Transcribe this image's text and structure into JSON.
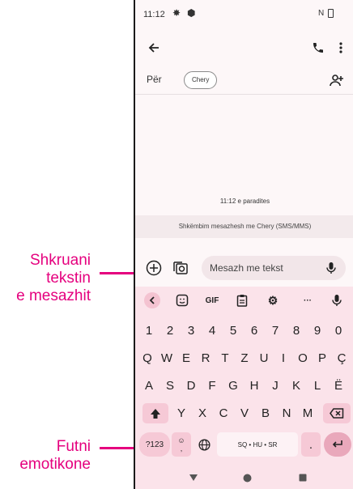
{
  "annotations": {
    "type_message": [
      "Shkruani",
      "tekstin",
      "e mesazhit"
    ],
    "insert_emoji": [
      "Futni",
      "emotikone"
    ]
  },
  "status_bar": {
    "time": "11:12"
  },
  "conversation": {
    "to_label": "Për",
    "recipient_chip": "Chery",
    "timestamp": "11:12 e paradites",
    "info_banner": "Shkëmbim mesazhesh me Chery (SMS/MMS)"
  },
  "composer": {
    "placeholder": "Mesazh me tekst"
  },
  "keyboard": {
    "toolbar": {
      "gif": "GIF",
      "more": "···"
    },
    "rows": [
      [
        "1",
        "2",
        "3",
        "4",
        "5",
        "6",
        "7",
        "8",
        "9",
        "0"
      ],
      [
        "Q",
        "W",
        "E",
        "R",
        "T",
        "Z",
        "U",
        "I",
        "O",
        "P",
        "Ç"
      ],
      [
        "A",
        "S",
        "D",
        "F",
        "G",
        "H",
        "J",
        "K",
        "L",
        "Ë"
      ],
      [
        "Y",
        "X",
        "C",
        "V",
        "B",
        "N",
        "M"
      ]
    ],
    "symbols_key": "?123",
    "emoji_key": "☺",
    "comma_key": ",",
    "space_label": "SQ • HU • SR",
    "period_key": "."
  },
  "colors": {
    "annotation": "#e5007e",
    "keyboard_bg": "#fbe3ea",
    "accent_key": "#f6c9d6",
    "enter_key": "#e9a8bb"
  }
}
